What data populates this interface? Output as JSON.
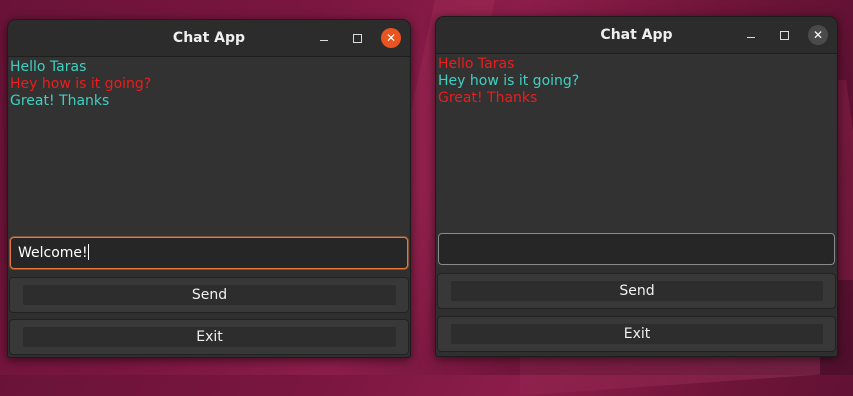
{
  "colors": {
    "accent_focus": "#e9773c",
    "close_active": "#e95420",
    "msg_cyan": "#3fd0c0",
    "msg_red": "#ee1c1c"
  },
  "windows": [
    {
      "title": "Chat App",
      "messages": [
        {
          "text": "Hello Taras",
          "color": "#3fd0c0"
        },
        {
          "text": "Hey how is it going?",
          "color": "#ee1c1c"
        },
        {
          "text": "Great! Thanks",
          "color": "#3fd0c0"
        }
      ],
      "input_value": "Welcome!",
      "send_label": "Send",
      "exit_label": "Exit",
      "controls": {
        "minimize_icon": "minimize-icon",
        "maximize_icon": "maximize-icon",
        "close_icon": "close-icon"
      }
    },
    {
      "title": "Chat App",
      "messages": [
        {
          "text": "Hello Taras",
          "color": "#ee1c1c"
        },
        {
          "text": "Hey how is it going?",
          "color": "#3fd0c0"
        },
        {
          "text": "Great! Thanks",
          "color": "#ee1c1c"
        }
      ],
      "input_value": "",
      "send_label": "Send",
      "exit_label": "Exit",
      "controls": {
        "minimize_icon": "minimize-icon",
        "maximize_icon": "maximize-icon",
        "close_icon": "close-icon"
      }
    }
  ]
}
